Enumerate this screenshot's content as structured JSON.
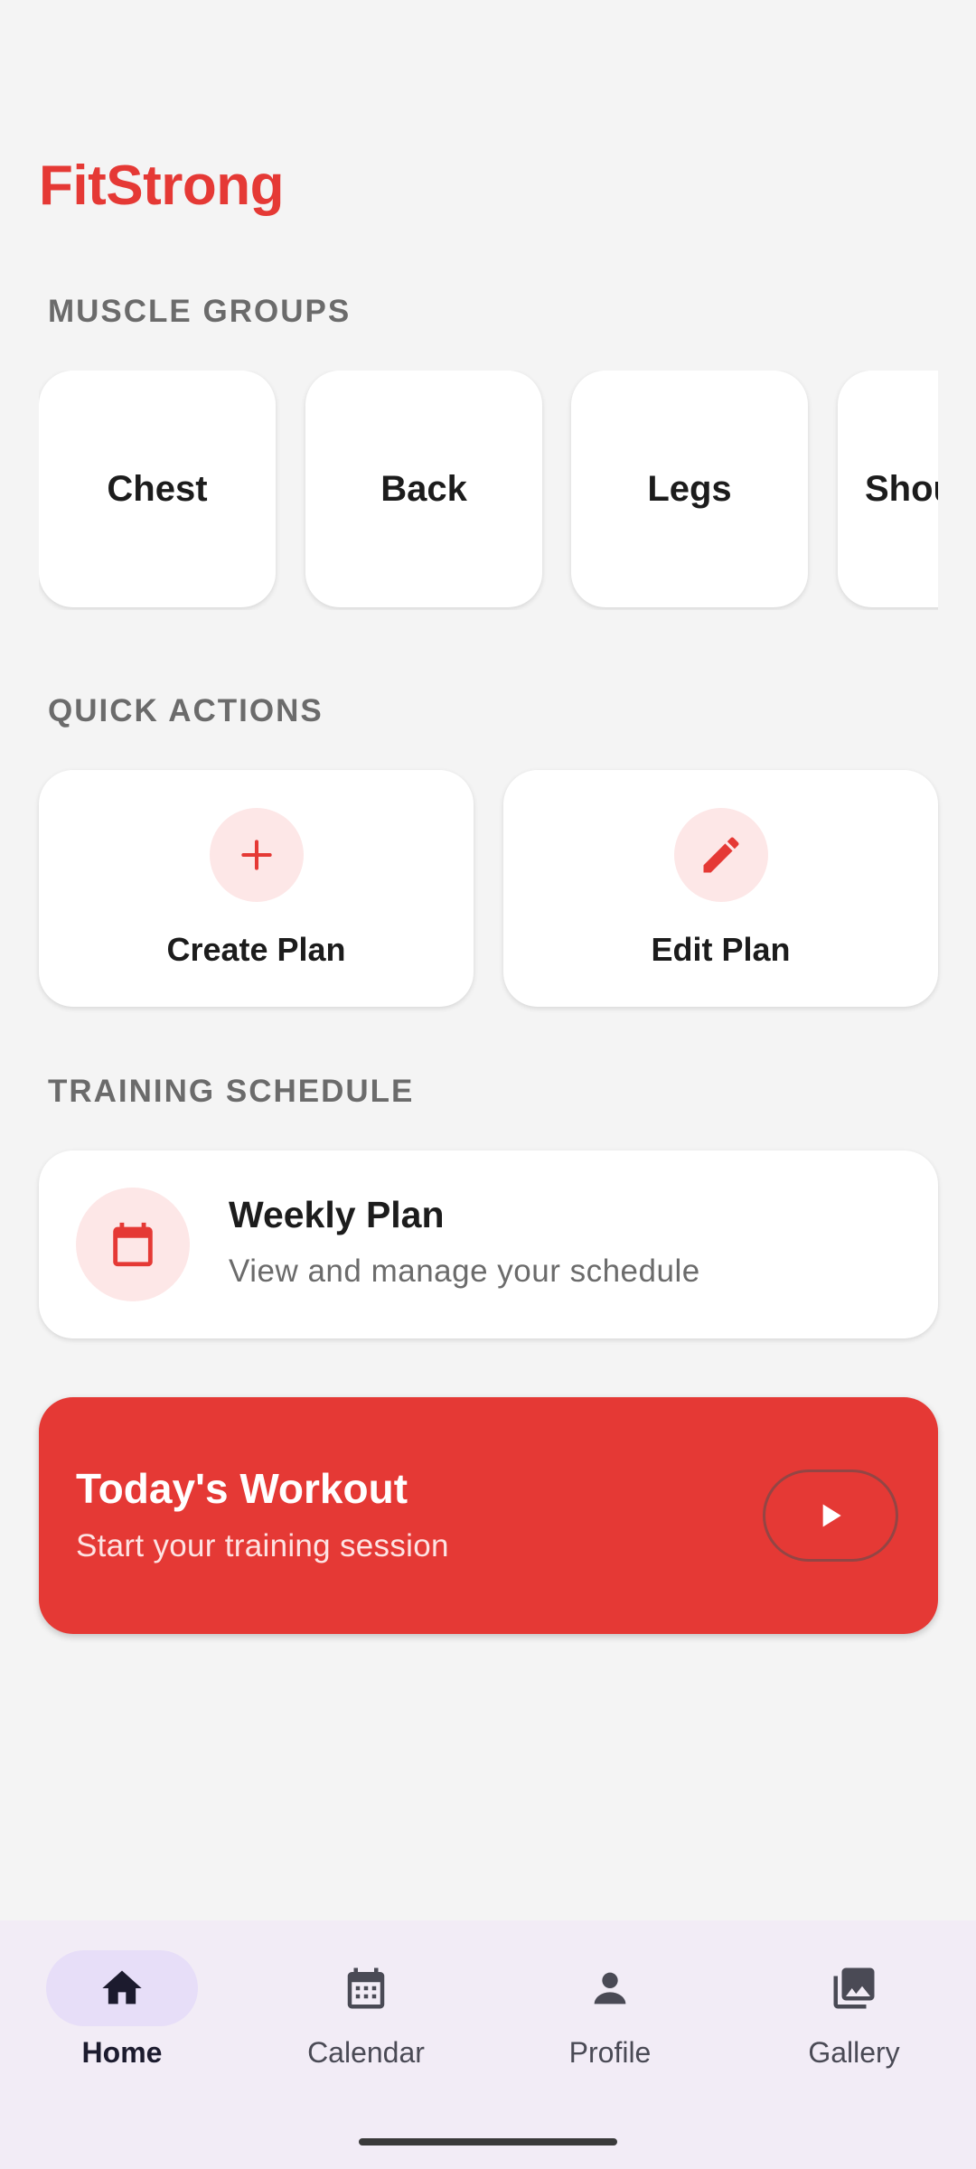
{
  "app": {
    "title": "FitStrong"
  },
  "sections": {
    "muscle_groups": "MUSCLE GROUPS",
    "quick_actions": "QUICK ACTIONS",
    "training_schedule": "TRAINING SCHEDULE"
  },
  "muscle_groups": [
    "Chest",
    "Back",
    "Legs",
    "Shoulders"
  ],
  "quick_actions": [
    {
      "label": "Create Plan",
      "icon": "plus-icon"
    },
    {
      "label": "Edit Plan",
      "icon": "pencil-icon"
    }
  ],
  "schedule": {
    "title": "Weekly Plan",
    "subtitle": "View and manage your schedule",
    "icon": "calendar-icon"
  },
  "workout": {
    "title": "Today's Workout",
    "subtitle": "Start your training session",
    "icon": "play-icon"
  },
  "nav": [
    {
      "label": "Home",
      "icon": "home-icon",
      "active": true
    },
    {
      "label": "Calendar",
      "icon": "calendar-icon",
      "active": false
    },
    {
      "label": "Profile",
      "icon": "person-icon",
      "active": false
    },
    {
      "label": "Gallery",
      "icon": "gallery-icon",
      "active": false
    }
  ],
  "colors": {
    "accent": "#e53935",
    "background": "#f4f4f4",
    "icon_bg": "#fde7e7",
    "nav_bg": "#f2ecf6",
    "nav_active_pill": "#e7def8"
  }
}
